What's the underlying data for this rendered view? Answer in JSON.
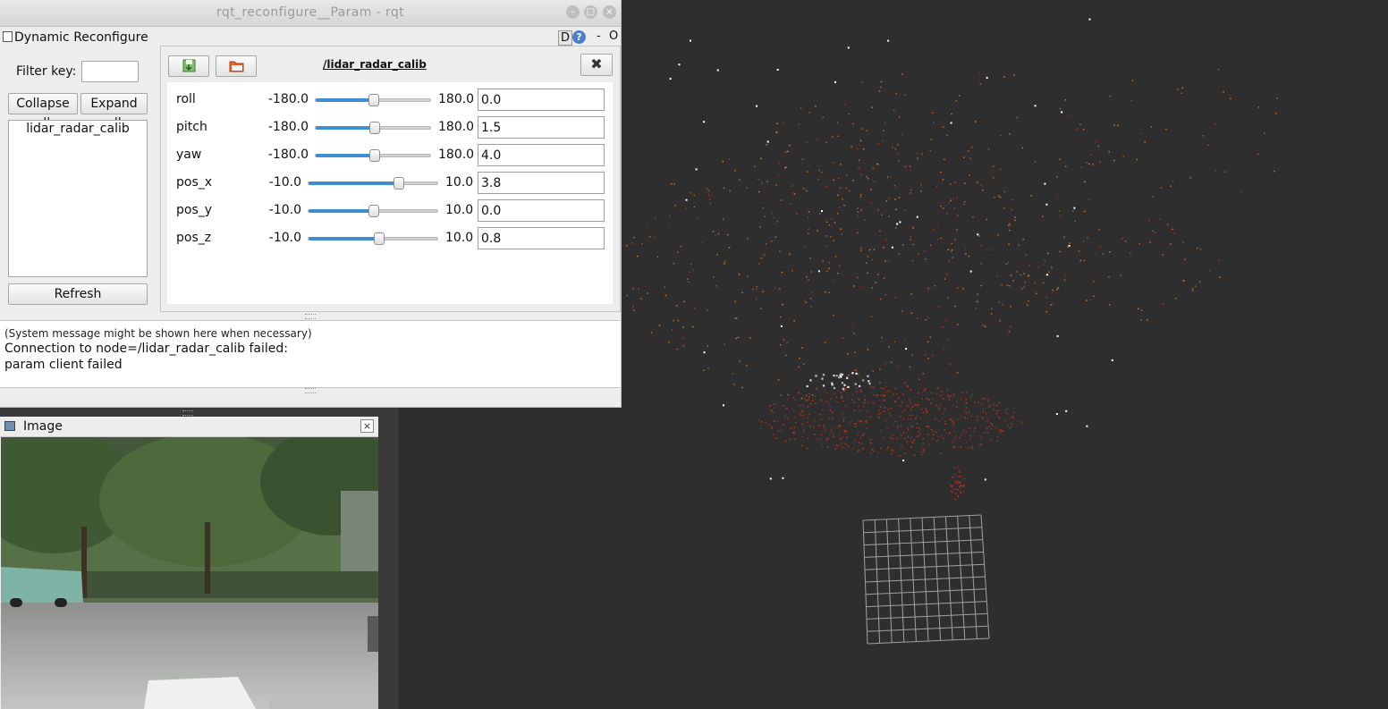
{
  "window": {
    "title": "rqt_reconfigure__Param - rqt",
    "controls": [
      "minimize-icon",
      "maximize-icon",
      "close-icon"
    ]
  },
  "plugin": {
    "name": "Dynamic Reconfigure",
    "d_label": "D",
    "help_label": "?",
    "dash_label": "-",
    "o_label": "O"
  },
  "filter": {
    "label": "Filter key:",
    "value": ""
  },
  "buttons": {
    "collapse_all": "Collapse all",
    "expand_all": "Expand all",
    "refresh": "Refresh"
  },
  "tree": {
    "items": [
      "lidar_radar_calib"
    ]
  },
  "node": {
    "title": "/lidar_radar_calib",
    "save_icon": "save-icon",
    "load_icon": "folder-icon",
    "close_label": "✖"
  },
  "params": [
    {
      "name": "roll",
      "min": "-180.0",
      "max": "180.0",
      "value": "0.0",
      "level": 0.5
    },
    {
      "name": "pitch",
      "min": "-180.0",
      "max": "180.0",
      "value": "1.5",
      "level": 0.504
    },
    {
      "name": "yaw",
      "min": "-180.0",
      "max": "180.0",
      "value": "4.0",
      "level": 0.511
    },
    {
      "name": "pos_x",
      "min": "-10.0",
      "max": "10.0",
      "value": "3.8",
      "level": 0.69
    },
    {
      "name": "pos_y",
      "min": "-10.0",
      "max": "10.0",
      "value": "0.0",
      "level": 0.5
    },
    {
      "name": "pos_z",
      "min": "-10.0",
      "max": "10.0",
      "value": "0.8",
      "level": 0.54
    }
  ],
  "messages": {
    "hint": "(System message might be shown here when necessary)",
    "line1": "Connection to node=/lidar_radar_calib failed:",
    "line2": "param client failed"
  },
  "image_window": {
    "title": "Image",
    "close_label": "×"
  },
  "colors": {
    "viewer_background": "#2e2e2e",
    "slider_fill": "#3d8fd1",
    "point_red": "#c6321e",
    "point_orange": "#e07a22",
    "point_white": "#ffffff",
    "grid": "#a0a0a0"
  }
}
